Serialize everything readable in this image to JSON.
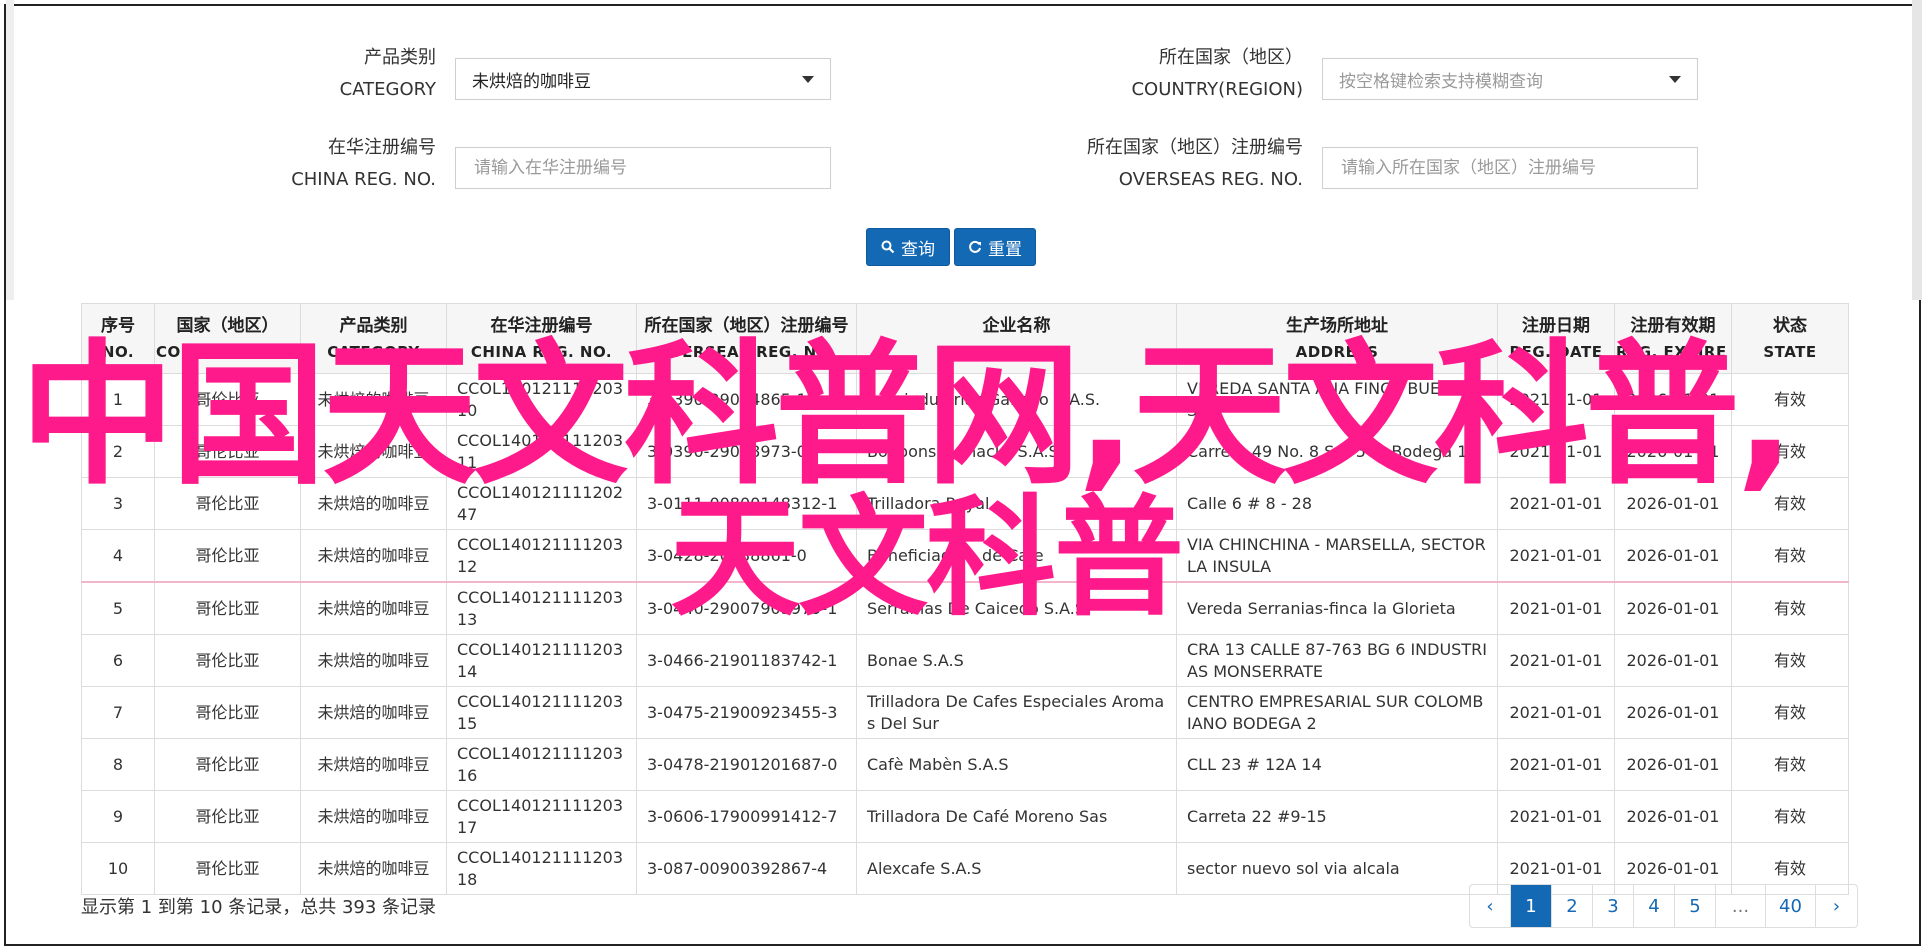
{
  "form": {
    "category": {
      "label_cn": "产品类别",
      "label_en": "CATEGORY",
      "value": "未烘焙的咖啡豆"
    },
    "country": {
      "label_cn": "所在国家（地区）",
      "label_en": "COUNTRY(REGION)",
      "placeholder": "按空格键检索支持模糊查询"
    },
    "china_reg": {
      "label_cn": "在华注册编号",
      "label_en": "CHINA REG. NO.",
      "placeholder": "请输入在华注册编号"
    },
    "overseas_reg": {
      "label_cn": "所在国家（地区）注册编号",
      "label_en": "OVERSEAS REG. NO.",
      "placeholder": "请输入所在国家（地区）注册编号"
    },
    "search_label": "查询",
    "reset_label": "重置"
  },
  "table": {
    "headers": [
      {
        "cn": "序号",
        "en": "NO."
      },
      {
        "cn": "国家（地区）",
        "en": "COUNTRY(REGIO..."
      },
      {
        "cn": "产品类别",
        "en": "CATEGORY"
      },
      {
        "cn": "在华注册编号",
        "en": "CHINA REG. NO."
      },
      {
        "cn": "所在国家（地区）注册编号",
        "en": "OVERSEAS REG. NO."
      },
      {
        "cn": "企业名称",
        "en": "NAME"
      },
      {
        "cn": "生产场所地址",
        "en": "ADDRESS"
      },
      {
        "cn": "注册日期",
        "en": "REG. DATE"
      },
      {
        "cn": "注册有效期",
        "en": "REG. EXPIRE ..."
      },
      {
        "cn": "状态",
        "en": "STATE"
      }
    ],
    "rows": [
      {
        "no": "1",
        "country": "哥伦比亚",
        "category": "未烘焙的咖啡豆",
        "china_reg": "CCOL140121111203 10",
        "overseas_reg": "3-0390-29004865-1",
        "name": "Agroindustrias Gallego S.A.S.",
        "address": "VEREDA SANTA ANA FINCA BUENAVISTA",
        "reg_date": "2021-01-01",
        "expire": "2026-01-01",
        "state": "有效"
      },
      {
        "no": "2",
        "country": "哥伦比亚",
        "category": "未烘焙的咖啡豆",
        "china_reg": "CCOL140121111203 11",
        "overseas_reg": "3-0390-29008973-0",
        "name": "Bonbons y Snacks S.A.S.",
        "address": "Carrera 49 No. 8 Sur-540 Bodega 10",
        "reg_date": "2021-01-01",
        "expire": "2026-01-01",
        "state": "有效"
      },
      {
        "no": "3",
        "country": "哥伦比亚",
        "category": "未烘焙的咖啡豆",
        "china_reg": "CCOL140121111202 47",
        "overseas_reg": "3-0111-00800148312-1",
        "name": "Trilladora Royal",
        "address": "Calle 6 # 8 - 28",
        "reg_date": "2021-01-01",
        "expire": "2026-01-01",
        "state": "有效"
      },
      {
        "no": "4",
        "country": "哥伦比亚",
        "category": "未烘焙的咖啡豆",
        "china_reg": "CCOL140121111203 12",
        "overseas_reg": "3-0428-20938861-0",
        "name": "Beneficiadero de Cafe",
        "address": "VIA CHINCHINA - MARSELLA, SECTOR LA INSULA",
        "reg_date": "2021-01-01",
        "expire": "2026-01-01",
        "state": "有效"
      },
      {
        "no": "5",
        "country": "哥伦比亚",
        "category": "未烘焙的咖啡豆",
        "china_reg": "CCOL140121111203 13",
        "overseas_reg": "3-0440-29007903979-1",
        "name": "Serranias De Caicedo S.A.S.",
        "address": "Vereda Serranias-finca la Glorieta",
        "reg_date": "2021-01-01",
        "expire": "2026-01-01",
        "state": "有效"
      },
      {
        "no": "6",
        "country": "哥伦比亚",
        "category": "未烘焙的咖啡豆",
        "china_reg": "CCOL140121111203 14",
        "overseas_reg": "3-0466-21901183742-1",
        "name": "Bonae S.A.S",
        "address": "CRA 13 CALLE 87-763 BG 6 INDUSTRIAS MONSERRATE",
        "reg_date": "2021-01-01",
        "expire": "2026-01-01",
        "state": "有效"
      },
      {
        "no": "7",
        "country": "哥伦比亚",
        "category": "未烘焙的咖啡豆",
        "china_reg": "CCOL140121111203 15",
        "overseas_reg": "3-0475-21900923455-3",
        "name": "Trilladora De Cafes Especiales Aromas Del Sur",
        "address": "CENTRO EMPRESARIAL SUR COLOMBIANO BODEGA 2",
        "reg_date": "2021-01-01",
        "expire": "2026-01-01",
        "state": "有效"
      },
      {
        "no": "8",
        "country": "哥伦比亚",
        "category": "未烘焙的咖啡豆",
        "china_reg": "CCOL140121111203 16",
        "overseas_reg": "3-0478-21901201687-0",
        "name": "Cafè Mabèn S.A.S",
        "address": "CLL 23 # 12A 14",
        "reg_date": "2021-01-01",
        "expire": "2026-01-01",
        "state": "有效"
      },
      {
        "no": "9",
        "country": "哥伦比亚",
        "category": "未烘焙的咖啡豆",
        "china_reg": "CCOL140121111203 17",
        "overseas_reg": "3-0606-17900991412-7",
        "name": "Trilladora De Café Moreno Sas",
        "address": "Carreta 22 #9-15",
        "reg_date": "2021-01-01",
        "expire": "2026-01-01",
        "state": "有效"
      },
      {
        "no": "10",
        "country": "哥伦比亚",
        "category": "未烘焙的咖啡豆",
        "china_reg": "CCOL140121111203 18",
        "overseas_reg": "3-087-00900392867-4",
        "name": "Alexcafe S.A.S",
        "address": "sector nuevo sol via alcala",
        "reg_date": "2021-01-01",
        "expire": "2026-01-01",
        "state": "有效"
      }
    ]
  },
  "footer": {
    "summary": "显示第 1 到第 10 条记录，总共 393 条记录",
    "pages": [
      "‹",
      "1",
      "2",
      "3",
      "4",
      "5",
      "...",
      "40",
      "›"
    ],
    "active_page": "1"
  },
  "watermark": {
    "line1": "中国天文科普网,天文科普,",
    "line2": "天文科普"
  },
  "colors": {
    "primary": "#1469b4",
    "watermark": "#ff1a8c"
  }
}
